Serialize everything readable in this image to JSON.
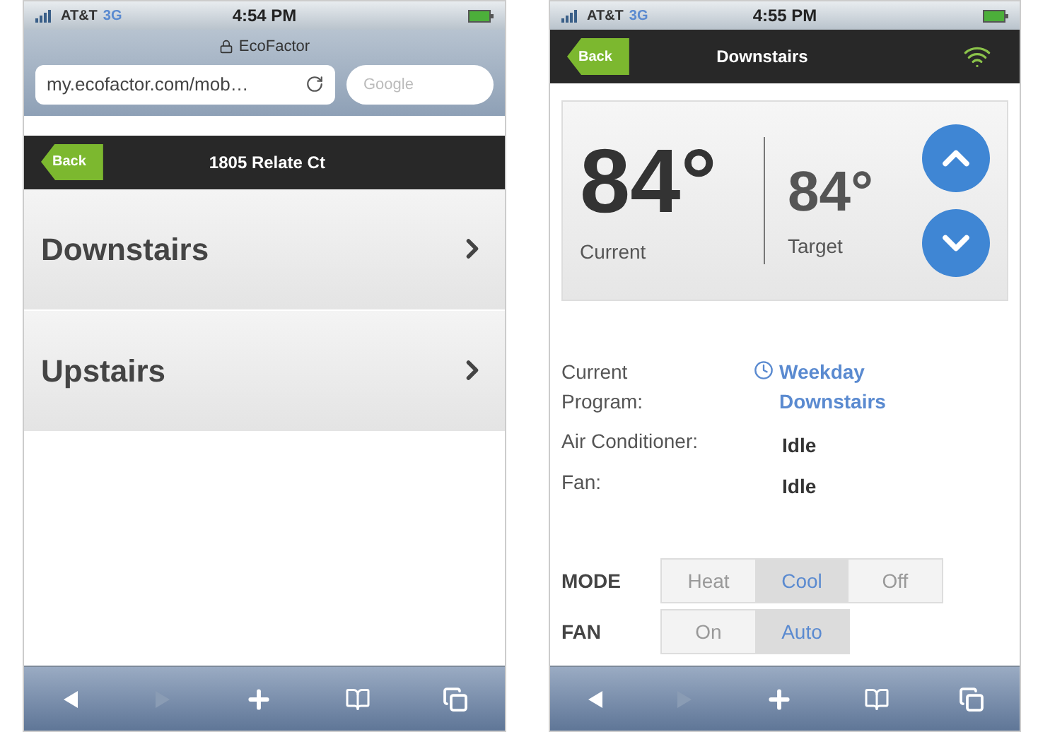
{
  "list_screen": {
    "status_bar": {
      "carrier": "AT&T",
      "network": "3G",
      "time": "4:54 PM"
    },
    "browser": {
      "title": "EcoFactor",
      "url": "my.ecofactor.com/mob…",
      "search": {
        "placeholder": "Google"
      }
    },
    "nav_bar": {
      "back": "Back",
      "title": "1805 Relate Ct"
    },
    "items": [
      {
        "label": "Downstairs"
      },
      {
        "label": "Upstairs"
      }
    ],
    "toolbar": [
      {
        "kind": "back",
        "disabled": false
      },
      {
        "kind": "forward",
        "disabled": true
      },
      {
        "kind": "add",
        "disabled": false
      },
      {
        "kind": "bookmarks",
        "disabled": false
      },
      {
        "kind": "pages",
        "disabled": false
      }
    ]
  },
  "detail_screen": {
    "status_bar": {
      "carrier": "AT&T",
      "network": "3G",
      "time": "4:55 PM"
    },
    "nav_bar": {
      "back": "Back",
      "title": "Downstairs"
    },
    "current": {
      "temp": "84°",
      "label": "Current"
    },
    "target": {
      "temp": "84°",
      "label": "Target"
    },
    "info": [
      {
        "kind": "link",
        "label": "Current Program:",
        "value": "Weekday Downstairs"
      },
      {
        "kind": "text",
        "label": "Air Conditioner:",
        "value": "Idle"
      },
      {
        "kind": "text",
        "label": "Fan:",
        "value": "Idle"
      }
    ],
    "controls": [
      {
        "label": "MODE",
        "options": [
          {
            "label": "Heat",
            "selected": false
          },
          {
            "label": "Cool",
            "selected": true
          },
          {
            "label": "Off",
            "selected": false
          }
        ]
      },
      {
        "label": "FAN",
        "options": [
          {
            "label": "On",
            "selected": false
          },
          {
            "label": "Auto",
            "selected": true
          }
        ]
      }
    ],
    "toolbar": [
      {
        "kind": "back",
        "disabled": false
      },
      {
        "kind": "forward",
        "disabled": true
      },
      {
        "kind": "add",
        "disabled": false
      },
      {
        "kind": "bookmarks",
        "disabled": false
      },
      {
        "kind": "pages",
        "disabled": false
      }
    ]
  }
}
